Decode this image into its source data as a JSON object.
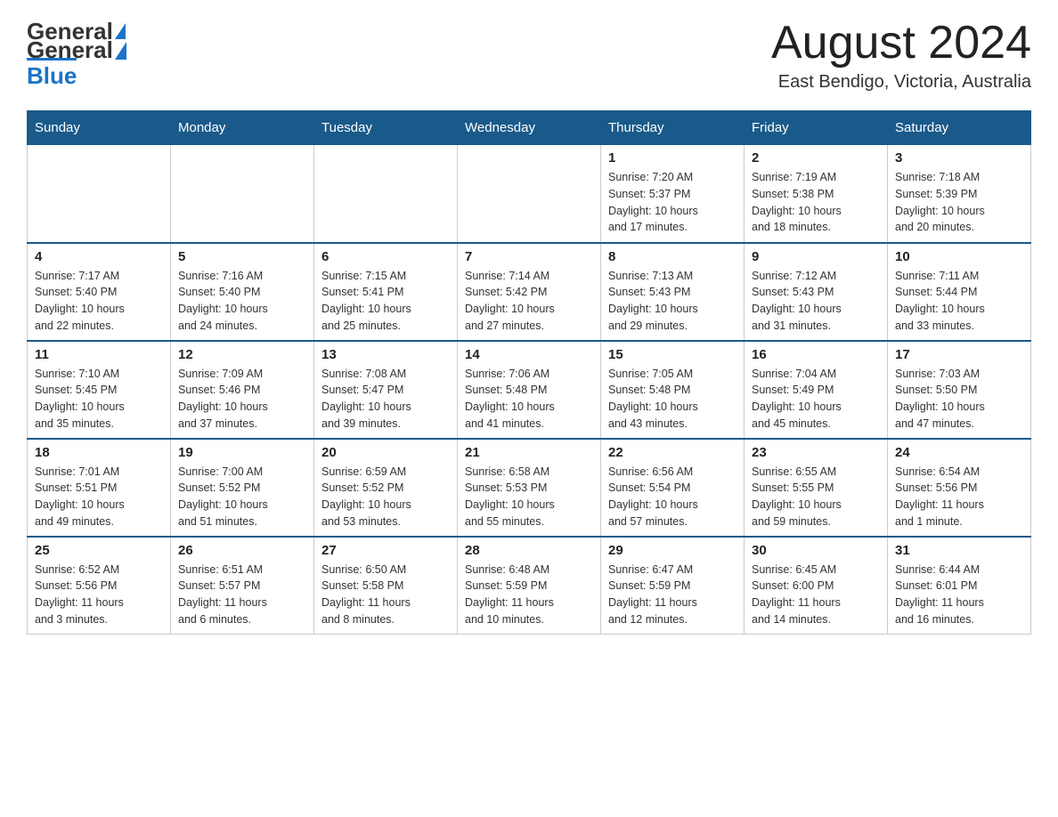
{
  "header": {
    "logo_general": "General",
    "logo_blue": "Blue",
    "title": "August 2024",
    "subtitle": "East Bendigo, Victoria, Australia"
  },
  "days_of_week": [
    "Sunday",
    "Monday",
    "Tuesday",
    "Wednesday",
    "Thursday",
    "Friday",
    "Saturday"
  ],
  "weeks": [
    [
      {
        "day": "",
        "info": ""
      },
      {
        "day": "",
        "info": ""
      },
      {
        "day": "",
        "info": ""
      },
      {
        "day": "",
        "info": ""
      },
      {
        "day": "1",
        "info": "Sunrise: 7:20 AM\nSunset: 5:37 PM\nDaylight: 10 hours\nand 17 minutes."
      },
      {
        "day": "2",
        "info": "Sunrise: 7:19 AM\nSunset: 5:38 PM\nDaylight: 10 hours\nand 18 minutes."
      },
      {
        "day": "3",
        "info": "Sunrise: 7:18 AM\nSunset: 5:39 PM\nDaylight: 10 hours\nand 20 minutes."
      }
    ],
    [
      {
        "day": "4",
        "info": "Sunrise: 7:17 AM\nSunset: 5:40 PM\nDaylight: 10 hours\nand 22 minutes."
      },
      {
        "day": "5",
        "info": "Sunrise: 7:16 AM\nSunset: 5:40 PM\nDaylight: 10 hours\nand 24 minutes."
      },
      {
        "day": "6",
        "info": "Sunrise: 7:15 AM\nSunset: 5:41 PM\nDaylight: 10 hours\nand 25 minutes."
      },
      {
        "day": "7",
        "info": "Sunrise: 7:14 AM\nSunset: 5:42 PM\nDaylight: 10 hours\nand 27 minutes."
      },
      {
        "day": "8",
        "info": "Sunrise: 7:13 AM\nSunset: 5:43 PM\nDaylight: 10 hours\nand 29 minutes."
      },
      {
        "day": "9",
        "info": "Sunrise: 7:12 AM\nSunset: 5:43 PM\nDaylight: 10 hours\nand 31 minutes."
      },
      {
        "day": "10",
        "info": "Sunrise: 7:11 AM\nSunset: 5:44 PM\nDaylight: 10 hours\nand 33 minutes."
      }
    ],
    [
      {
        "day": "11",
        "info": "Sunrise: 7:10 AM\nSunset: 5:45 PM\nDaylight: 10 hours\nand 35 minutes."
      },
      {
        "day": "12",
        "info": "Sunrise: 7:09 AM\nSunset: 5:46 PM\nDaylight: 10 hours\nand 37 minutes."
      },
      {
        "day": "13",
        "info": "Sunrise: 7:08 AM\nSunset: 5:47 PM\nDaylight: 10 hours\nand 39 minutes."
      },
      {
        "day": "14",
        "info": "Sunrise: 7:06 AM\nSunset: 5:48 PM\nDaylight: 10 hours\nand 41 minutes."
      },
      {
        "day": "15",
        "info": "Sunrise: 7:05 AM\nSunset: 5:48 PM\nDaylight: 10 hours\nand 43 minutes."
      },
      {
        "day": "16",
        "info": "Sunrise: 7:04 AM\nSunset: 5:49 PM\nDaylight: 10 hours\nand 45 minutes."
      },
      {
        "day": "17",
        "info": "Sunrise: 7:03 AM\nSunset: 5:50 PM\nDaylight: 10 hours\nand 47 minutes."
      }
    ],
    [
      {
        "day": "18",
        "info": "Sunrise: 7:01 AM\nSunset: 5:51 PM\nDaylight: 10 hours\nand 49 minutes."
      },
      {
        "day": "19",
        "info": "Sunrise: 7:00 AM\nSunset: 5:52 PM\nDaylight: 10 hours\nand 51 minutes."
      },
      {
        "day": "20",
        "info": "Sunrise: 6:59 AM\nSunset: 5:52 PM\nDaylight: 10 hours\nand 53 minutes."
      },
      {
        "day": "21",
        "info": "Sunrise: 6:58 AM\nSunset: 5:53 PM\nDaylight: 10 hours\nand 55 minutes."
      },
      {
        "day": "22",
        "info": "Sunrise: 6:56 AM\nSunset: 5:54 PM\nDaylight: 10 hours\nand 57 minutes."
      },
      {
        "day": "23",
        "info": "Sunrise: 6:55 AM\nSunset: 5:55 PM\nDaylight: 10 hours\nand 59 minutes."
      },
      {
        "day": "24",
        "info": "Sunrise: 6:54 AM\nSunset: 5:56 PM\nDaylight: 11 hours\nand 1 minute."
      }
    ],
    [
      {
        "day": "25",
        "info": "Sunrise: 6:52 AM\nSunset: 5:56 PM\nDaylight: 11 hours\nand 3 minutes."
      },
      {
        "day": "26",
        "info": "Sunrise: 6:51 AM\nSunset: 5:57 PM\nDaylight: 11 hours\nand 6 minutes."
      },
      {
        "day": "27",
        "info": "Sunrise: 6:50 AM\nSunset: 5:58 PM\nDaylight: 11 hours\nand 8 minutes."
      },
      {
        "day": "28",
        "info": "Sunrise: 6:48 AM\nSunset: 5:59 PM\nDaylight: 11 hours\nand 10 minutes."
      },
      {
        "day": "29",
        "info": "Sunrise: 6:47 AM\nSunset: 5:59 PM\nDaylight: 11 hours\nand 12 minutes."
      },
      {
        "day": "30",
        "info": "Sunrise: 6:45 AM\nSunset: 6:00 PM\nDaylight: 11 hours\nand 14 minutes."
      },
      {
        "day": "31",
        "info": "Sunrise: 6:44 AM\nSunset: 6:01 PM\nDaylight: 11 hours\nand 16 minutes."
      }
    ]
  ]
}
